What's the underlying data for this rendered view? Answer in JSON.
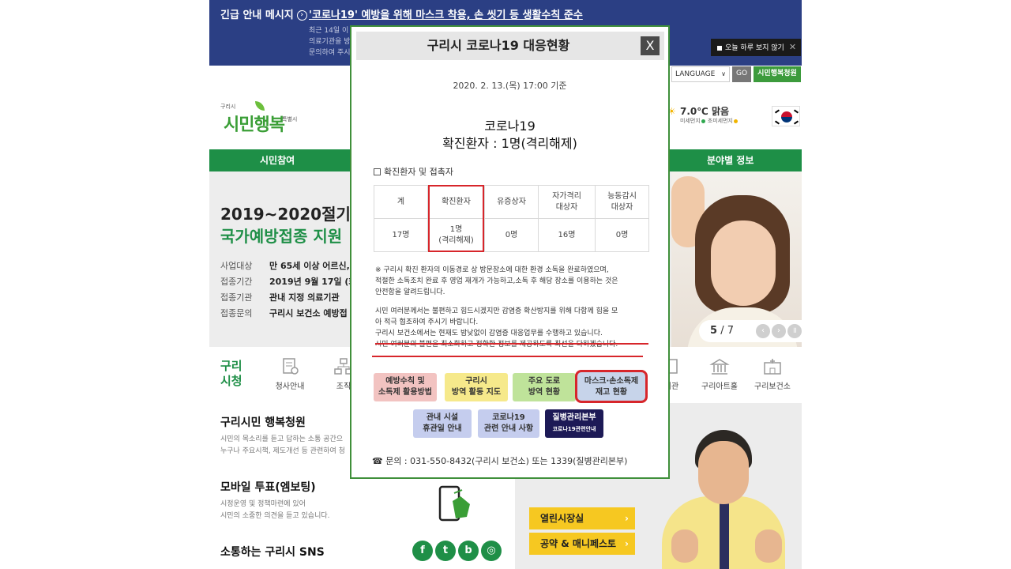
{
  "emergency": {
    "label": "긴급 안내 메시지",
    "headline": "'코로나19' 예방을 위해 마스크 착용, 손 씻기 등 생활수칙 준수",
    "sub_lines": [
      "최근 14일 이",
      "의료기관을 방",
      "문의하여 주시"
    ],
    "dismiss_label": "오늘 하루 보지 않기"
  },
  "utility": {
    "language": "LANGUAGE",
    "go": "GO",
    "petition": "시민행복청원"
  },
  "logo": {
    "small": "구리시",
    "main": "시민행복",
    "spec": "특별시"
  },
  "weather": {
    "temp": "7.0℃ 맑음",
    "fine_dust": "미세먼지",
    "ultra_dust": "초미세먼지",
    "dust_color": "#2fa84f",
    "ultra_color": "#f0b400"
  },
  "nav": {
    "left": "시민참여",
    "right": "분야별 정보"
  },
  "hero": {
    "title1": "2019~2020절기 인",
    "title2": "국가예방접종 지원",
    "rows": [
      {
        "k": "사업대상",
        "v": "만 65세 이상 어르신, "
      },
      {
        "k": "접종기간",
        "v": "2019년 9월 17일 (화)"
      },
      {
        "k": "접종기관",
        "v": "관내 지정 의료기관"
      },
      {
        "k": "접종문의",
        "v": "구리시 보건소 예방접"
      }
    ],
    "page_current": "5",
    "page_total": "/ 7"
  },
  "quick": {
    "city": "구리 시청",
    "items": [
      "청사안내",
      "조직",
      "서관",
      "구리아트홀",
      "구리보건소"
    ]
  },
  "left": {
    "petition_title": "구리시민 행복청원",
    "petition_desc": [
      "시민의 목소리를 듣고 답하는 소통 공간으",
      "누구나 주요시책, 제도개선 등 관련하여 청"
    ],
    "vote_title": "모바일 투표(엠보팅)",
    "vote_desc": [
      "시정운영 및 정책마련에 있어",
      "시민의 소중한 의견을 듣고 있습니다."
    ],
    "sns_title": "소통하는 구리시 SNS",
    "sns_icons": [
      "f",
      "t",
      "b",
      "◎"
    ]
  },
  "mayor": {
    "btn1": "열린시장실",
    "btn2": "공약 & 매니페스토"
  },
  "popup": {
    "title": "구리시 코로나19 대응현황",
    "close": "X",
    "date": "2020. 2. 13.(목) 17:00 기준",
    "big1": "코로나19",
    "big2": "확진환자 : 1명(격리해제)",
    "subtitle": "확진환자 및 접촉자",
    "table": {
      "headers": [
        [
          "계"
        ],
        [
          "확진환자"
        ],
        [
          "유증상자"
        ],
        [
          "자가격리",
          "대상자"
        ],
        [
          "능동감시",
          "대상자"
        ]
      ],
      "values": [
        [
          "17명"
        ],
        [
          "1명",
          "(격리해제)"
        ],
        [
          "0명"
        ],
        [
          "16명"
        ],
        [
          "0명"
        ]
      ]
    },
    "notes": [
      [
        "※ 구리시 확진 환자의 이동경로 상 방문장소에 대한 환경 소독을 완료하였으며,",
        "적절한 소독조치 완료 후 영업 재개가 가능하고,소독 후 해당 장소를 이용하는 것은",
        "안전함을 알려드립니다."
      ],
      [
        "시민 여러분께서는 불편하고 힘드시겠지만 감염증 확산방지를 위해 다함께 힘을 모",
        "아 적극 협조하여 주시기 바랍니다.",
        "구리시 보건소에서는 현재도 밤낮없이 감염증 대응업무를 수행하고 있습니다.",
        "시민 여러분의 불편을 최소화하고 정확한 정보를 제공하도록 최선을 다하겠습니다."
      ]
    ],
    "buttons_row1": [
      [
        "예방수칙 및",
        "소독제 활용방법"
      ],
      [
        "구리시",
        "방역 활동 지도"
      ],
      [
        "주요 도로",
        "방역 현황"
      ],
      [
        "마스크·손소독제",
        "재고 현황"
      ]
    ],
    "buttons_row2": [
      [
        "관내 시설",
        "휴관일 안내"
      ],
      [
        "코로나19",
        "관련 안내 사항"
      ],
      [
        "질병관리본부",
        "코로나19관련안내"
      ]
    ],
    "contact": "☎ 문의 : 031-550-8432(구리시 보건소) 또는 1339(질병관리본부)",
    "accent_red": "#d7262b",
    "accent_green": "#3f8f3a"
  }
}
